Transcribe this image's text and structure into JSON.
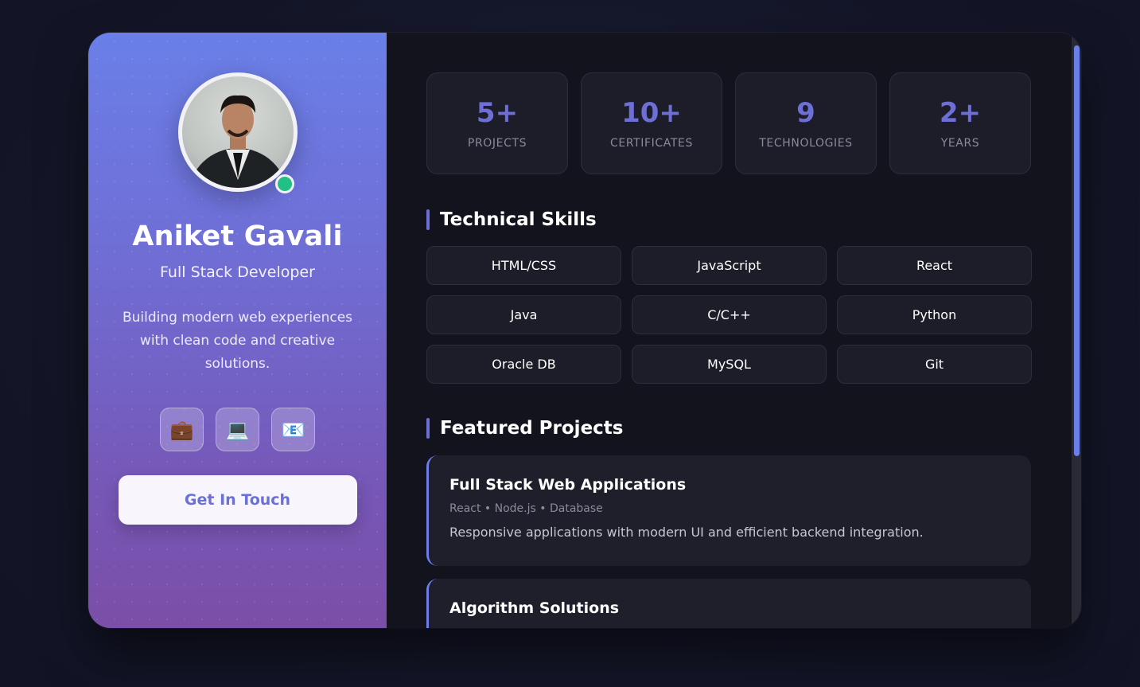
{
  "profile": {
    "name": "Aniket Gavali",
    "role": "Full Stack Developer",
    "bio": "Building modern web experiences with clean code and creative solutions.",
    "status": "online",
    "socials": [
      {
        "icon": "briefcase-icon",
        "glyph": "💼"
      },
      {
        "icon": "laptop-icon",
        "glyph": "💻"
      },
      {
        "icon": "email-icon",
        "glyph": "📧"
      }
    ],
    "cta_label": "Get In Touch"
  },
  "stats": [
    {
      "value": "5+",
      "label": "PROJECTS"
    },
    {
      "value": "10+",
      "label": "CERTIFICATES"
    },
    {
      "value": "9",
      "label": "TECHNOLOGIES"
    },
    {
      "value": "2+",
      "label": "YEARS"
    }
  ],
  "skills": {
    "title": "Technical Skills",
    "items": [
      "HTML/CSS",
      "JavaScript",
      "React",
      "Java",
      "C/C++",
      "Python",
      "Oracle DB",
      "MySQL",
      "Git"
    ]
  },
  "projects": {
    "title": "Featured Projects",
    "items": [
      {
        "title": "Full Stack Web Applications",
        "tags": "React • Node.js • Database",
        "description": "Responsive applications with modern UI and efficient backend integration."
      },
      {
        "title": "Algorithm Solutions",
        "tags": "",
        "description": ""
      }
    ]
  },
  "colors": {
    "accent": "#6d6fd6",
    "status_online": "#22c084",
    "panel_gradient_top": "#6a7fe8",
    "panel_gradient_bottom": "#7b4ea7"
  }
}
